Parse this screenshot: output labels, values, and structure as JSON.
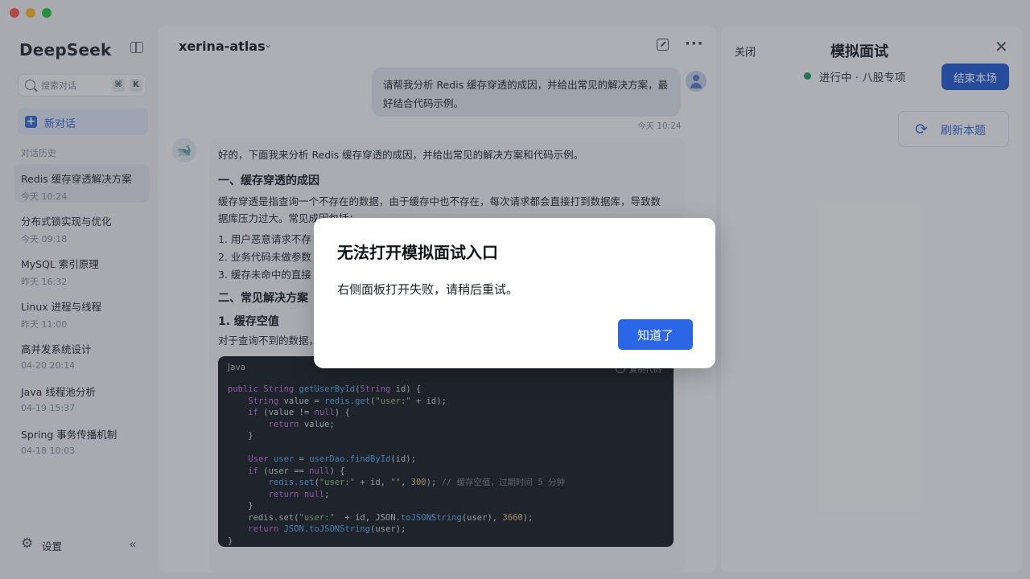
{
  "app": {
    "name": "DeepSeek"
  },
  "sidebar": {
    "search_placeholder": "搜索对话",
    "shortcut_cmd": "⌘",
    "shortcut_key": "K",
    "new_chat_label": "新对话",
    "history_title": "对话历史",
    "items": [
      {
        "title": "Redis 缓存穿透解决方案",
        "time": "今天 10:24",
        "active": true
      },
      {
        "title": "分布式锁实现与优化",
        "time": "今天 09:18"
      },
      {
        "title": "MySQL 索引原理",
        "time": "昨天 16:32"
      },
      {
        "title": "Linux 进程与线程",
        "time": "昨天 11:00"
      },
      {
        "title": "高并发系统设计",
        "time": "04-20 20:14"
      },
      {
        "title": "Java 线程池分析",
        "time": "04-19 15:37"
      },
      {
        "title": "Spring 事务传播机制",
        "time": "04-18 10:03"
      }
    ],
    "settings_label": "设置"
  },
  "chat": {
    "title": "xerina-atlas",
    "user_message": "请帮我分析 Redis 缓存穿透的成因，并给出常见的解决方案，最好结合代码示例。",
    "user_message_time": "今天 10:24",
    "bot_intro": "好的，下面我来分析 Redis 缓存穿透的成因，并给出常见的解决方案和代码示例。",
    "section1_title": "一、缓存穿透的成因",
    "section1_para": "缓存穿透是指查询一个不存在的数据，由于缓存中也不存在，每次请求都会直接打到数据库，导致数据库压力过大。常见成因包括：",
    "section1_list": [
      "1.  用户恶意请求不存",
      "2.  业务代码未做参数",
      "3.  缓存未命中的直接"
    ],
    "section2_title": "二、常见解决方案",
    "section2_sub": "1. 缓存空值",
    "section2_para": "对于查询不到的数据，",
    "code_lang": "Java",
    "code_copy": "复制代码"
  },
  "panel": {
    "close_label": "关闭",
    "title": "模拟面试",
    "status": "进行中 · 八股专项",
    "status_color": "#22a06b",
    "end_button": "结束本场",
    "refresh_button": "刷新本题"
  },
  "modal": {
    "title": "无法打开模拟面试入口",
    "body": "右侧面板打开失败，请稍后重试。",
    "ok_button": "知道了"
  },
  "colors": {
    "accent": "#2a66e6",
    "overlay": "rgba(32,36,44,0.34)"
  }
}
